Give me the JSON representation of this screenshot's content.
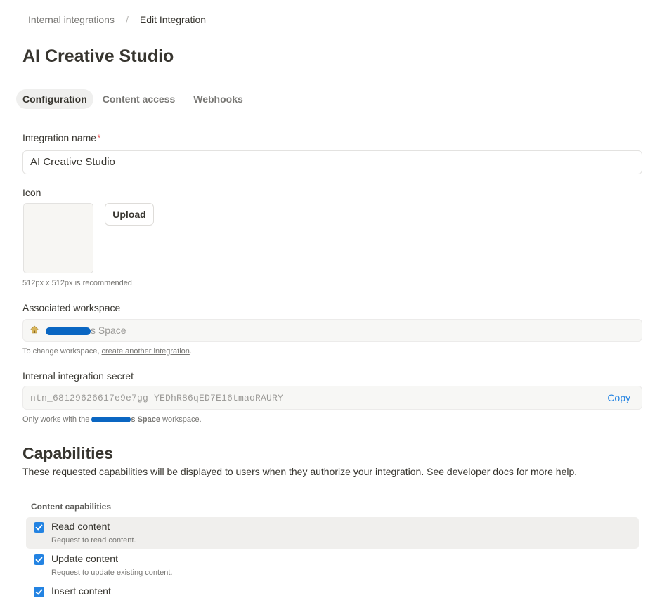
{
  "breadcrumb": {
    "parent": "Internal integrations",
    "separator": "/",
    "current": "Edit Integration"
  },
  "page_title": "AI Creative Studio",
  "tabs": [
    {
      "label": "Configuration",
      "active": true
    },
    {
      "label": "Content access",
      "active": false
    },
    {
      "label": "Webhooks",
      "active": false
    }
  ],
  "form": {
    "name_label": "Integration name",
    "required_mark": "*",
    "name_value": "AI Creative Studio",
    "icon_label": "Icon",
    "upload_label": "Upload",
    "icon_hint": "512px x 512px is recommended",
    "workspace_label": "Associated workspace",
    "workspace_value_suffix": "s Space",
    "workspace_hint_prefix": "To change workspace, ",
    "workspace_hint_link": "create another integration",
    "workspace_hint_suffix": ".",
    "secret_label": "Internal integration secret",
    "secret_value": "ntn_68129626617e9e7gg    YEDhR86qED7E16tmaoRAURY",
    "copy_label": "Copy",
    "secret_hint_prefix": "Only works with the ",
    "secret_hint_workspace": "s Space",
    "secret_hint_suffix": " workspace."
  },
  "capabilities": {
    "title": "Capabilities",
    "desc_prefix": "These requested capabilities will be displayed to users when they authorize your integration. See ",
    "desc_link": "developer docs",
    "desc_suffix": " for more help.",
    "group_label": "Content capabilities",
    "items": [
      {
        "title": "Read content",
        "subtitle": "Request to read content.",
        "checked": true
      },
      {
        "title": "Update content",
        "subtitle": "Request to update existing content.",
        "checked": true
      },
      {
        "title": "Insert content",
        "subtitle": "",
        "checked": true
      }
    ]
  },
  "colors": {
    "accent": "#2383e2",
    "required": "#eb5757",
    "redaction": "#0a66c2"
  }
}
